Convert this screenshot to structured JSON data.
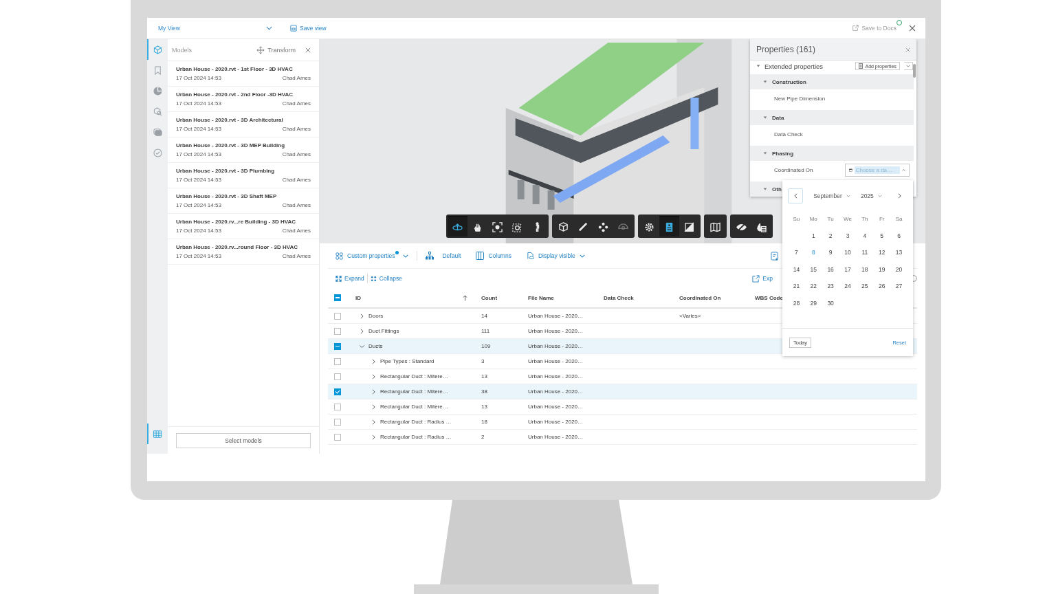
{
  "top_bar": {
    "view": "My View",
    "save_view": "Save view",
    "save_to_docs": "Save to Docs",
    "notification": true
  },
  "rail_top": [
    {
      "kind": "models",
      "selected": true
    },
    {
      "kind": "bookmarks",
      "selected": false
    },
    {
      "kind": "globe",
      "selected": false
    },
    {
      "kind": "search",
      "selected": false
    },
    {
      "kind": "layers",
      "selected": false
    },
    {
      "kind": "issues",
      "selected": false
    }
  ],
  "rail_bottom": [
    {
      "kind": "table",
      "selected": true
    }
  ],
  "models_panel": {
    "title": "Models",
    "transform": "Transform",
    "items": [
      {
        "name": "Urban House - 2020.rvt - 1st Floor - 3D HVAC",
        "date": "17 Oct 2024 14:53",
        "author": "Chad Ames"
      },
      {
        "name": "Urban House - 2020.rvt - 2nd Floor -3D HVAC",
        "date": "17 Oct 2024 14:53",
        "author": "Chad Ames"
      },
      {
        "name": "Urban House - 2020.rvt - 3D Architectural",
        "date": "17 Oct 2024 14:53",
        "author": "Chad Ames"
      },
      {
        "name": "Urban House - 2020.rvt - 3D MEP Building",
        "date": "17 Oct 2024 14:53",
        "author": "Chad Ames"
      },
      {
        "name": "Urban House - 2020.rvt - 3D Plumbing",
        "date": "17 Oct 2024 14:53",
        "author": "Chad Ames"
      },
      {
        "name": "Urban House - 2020.rvt - 3D Shaft MEP",
        "date": "17 Oct 2024 14:53",
        "author": "Chad Ames"
      },
      {
        "name": "Urban House - 2020.rv...re Building - 3D HVAC",
        "date": "17 Oct 2024 14:53",
        "author": "Chad Ames"
      },
      {
        "name": "Urban House - 2020.rv...round Floor - 3D HVAC",
        "date": "17 Oct 2024 14:53",
        "author": "Chad Ames"
      }
    ],
    "select_button": "Select models"
  },
  "viewer_toolbar": [
    {
      "tools": [
        {
          "kind": "orbit",
          "selected": true,
          "disabled": false
        },
        {
          "kind": "pan",
          "selected": false,
          "disabled": false
        },
        {
          "kind": "fit",
          "selected": false,
          "disabled": false
        },
        {
          "kind": "zoom-window",
          "selected": false,
          "disabled": false
        },
        {
          "kind": "walk",
          "selected": false,
          "disabled": false
        }
      ]
    },
    {
      "tools": [
        {
          "kind": "section",
          "selected": false,
          "disabled": false
        },
        {
          "kind": "measure",
          "selected": false,
          "disabled": false
        },
        {
          "kind": "explode",
          "selected": false,
          "disabled": false
        },
        {
          "kind": "hide",
          "selected": false,
          "disabled": true
        }
      ]
    },
    {
      "tools": [
        {
          "kind": "settings",
          "selected": false,
          "disabled": false
        },
        {
          "kind": "properties",
          "selected": true,
          "disabled": false
        },
        {
          "kind": "browser",
          "selected": false,
          "disabled": false
        }
      ]
    },
    {
      "tools": [
        {
          "kind": "map",
          "selected": false,
          "disabled": false
        }
      ]
    },
    {
      "tools": [
        {
          "kind": "visibility",
          "selected": false,
          "disabled": false
        },
        {
          "kind": "data",
          "selected": false,
          "disabled": false
        }
      ]
    }
  ],
  "properties": {
    "title": "Properties (161)",
    "section": "Extended properties",
    "section_expanded": true,
    "add_button": "Add properties",
    "groups": [
      {
        "name": "Construction",
        "expanded": true,
        "rows": [
          {
            "label": "New Pipe Dimension"
          }
        ]
      },
      {
        "name": "Data",
        "expanded": true,
        "rows": [
          {
            "label": "Data Check"
          }
        ]
      },
      {
        "name": "Phasing",
        "expanded": true,
        "rows": [
          {
            "label": "Coordinated On",
            "date_placeholder": "Choose a da…",
            "open": true
          }
        ]
      },
      {
        "name": "Oth",
        "expanded": true
      }
    ]
  },
  "calendar": {
    "month": "September",
    "year": "2025",
    "weekdays": [
      "Su",
      "Mo",
      "Tu",
      "We",
      "Th",
      "Fr",
      "Sa"
    ],
    "weeks": [
      {
        "days": [
          {
            "label": "1",
            "today": false
          },
          {
            "label": "2",
            "today": false
          },
          {
            "label": "3",
            "today": false
          },
          {
            "label": "4",
            "today": false
          },
          {
            "label": "5",
            "today": false
          },
          {
            "label": "6",
            "today": false
          }
        ]
      },
      {
        "days": [
          {
            "label": "7",
            "today": false
          },
          {
            "label": "8",
            "today": true
          },
          {
            "label": "9",
            "today": false
          },
          {
            "label": "10",
            "today": false
          },
          {
            "label": "11",
            "today": false
          },
          {
            "label": "12",
            "today": false
          },
          {
            "label": "13",
            "today": false
          }
        ]
      },
      {
        "days": [
          {
            "label": "14",
            "today": false
          },
          {
            "label": "15",
            "today": false
          },
          {
            "label": "16",
            "today": false
          },
          {
            "label": "17",
            "today": false
          },
          {
            "label": "18",
            "today": false
          },
          {
            "label": "19",
            "today": false
          },
          {
            "label": "20",
            "today": false
          }
        ]
      },
      {
        "days": [
          {
            "label": "21",
            "today": false
          },
          {
            "label": "22",
            "today": false
          },
          {
            "label": "23",
            "today": false
          },
          {
            "label": "24",
            "today": false
          },
          {
            "label": "25",
            "today": false
          },
          {
            "label": "26",
            "today": false
          },
          {
            "label": "27",
            "today": false
          }
        ]
      },
      {
        "days": [
          {
            "label": "28",
            "today": false
          },
          {
            "label": "29",
            "today": false
          },
          {
            "label": "30",
            "today": false
          }
        ]
      }
    ],
    "today_button": "Today",
    "reset": "Reset"
  },
  "table_toolbar": {
    "custom_properties": "Custom properties",
    "modified": true,
    "default": "Default",
    "columns": "Columns",
    "display": "Display visible"
  },
  "table_actions": {
    "expand": "Expand",
    "collapse": "Collapse",
    "export": "Exp"
  },
  "table": {
    "header_checked": true,
    "header_partial": true,
    "columns": [
      {
        "label": "ID",
        "sort_ascending": true
      },
      {
        "label": "Count"
      },
      {
        "label": "File Name"
      },
      {
        "label": "Data Check"
      },
      {
        "label": "Coordinated On"
      },
      {
        "label": "WBS Code"
      }
    ],
    "rows": [
      {
        "label": "Doors",
        "count": "14",
        "file_name": "Urban House - 2020…",
        "coordinated_on": "<Varies>",
        "checked": false,
        "expanded": false
      },
      {
        "label": "Duct Fittings",
        "count": "111",
        "file_name": "Urban House - 2020…",
        "checked": false,
        "expanded": false
      },
      {
        "label": "Ducts",
        "count": "109",
        "file_name": "Urban House - 2020…",
        "checked": true,
        "partial": true,
        "expanded": true,
        "children": [
          {
            "label": "Pipe Types : Standard",
            "count": "3",
            "file_name": "Urban House - 2020…",
            "checked": false,
            "expanded": false
          },
          {
            "label": "Rectangular Duct : Mitere…",
            "count": "13",
            "file_name": "Urban House - 2020…",
            "checked": false,
            "expanded": false
          },
          {
            "label": "Rectangular Duct : Mitere…",
            "count": "38",
            "file_name": "Urban House - 2020…",
            "checked": true,
            "expanded": false
          },
          {
            "label": "Rectangular Duct : Mitere…",
            "count": "13",
            "file_name": "Urban House - 2020…",
            "checked": false,
            "expanded": false
          },
          {
            "label": "Rectangular Duct : Radius …",
            "count": "18",
            "file_name": "Urban House - 2020…",
            "checked": false,
            "expanded": false
          },
          {
            "label": "Rectangular Duct : Radius …",
            "count": "2",
            "file_name": "Urban House - 2020…",
            "checked": false,
            "expanded": false
          }
        ]
      }
    ]
  }
}
